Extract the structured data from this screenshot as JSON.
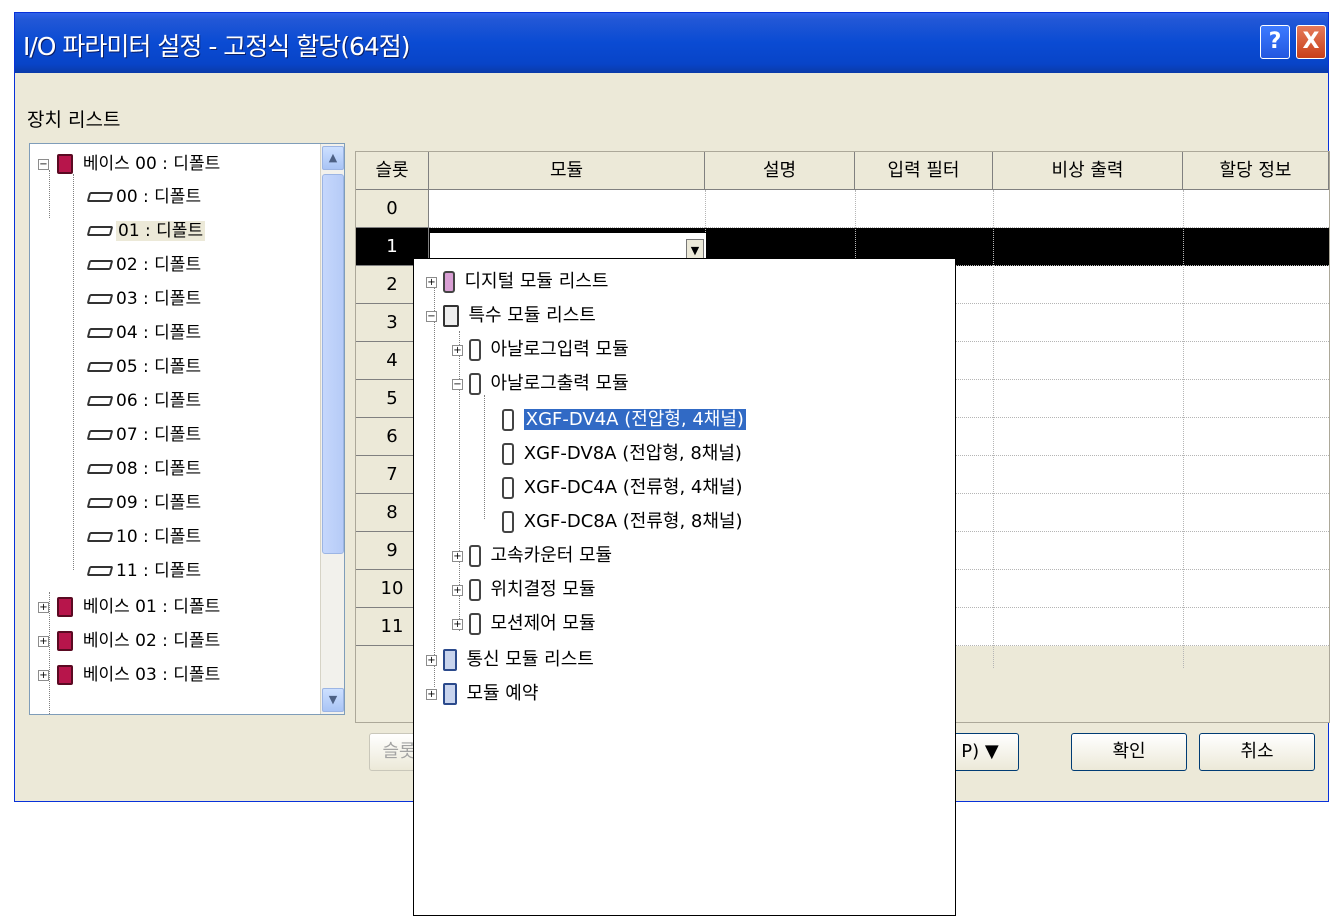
{
  "window": {
    "title": "I/O 파라미터 설정 - 고정식 할당(64점)",
    "help": "?",
    "close": "X"
  },
  "device_list_label": "장치 리스트",
  "tree": {
    "bases": [
      {
        "label": "베이스 00 : 디폴트",
        "expander": "−"
      },
      {
        "label": "베이스 01 : 디폴트",
        "expander": "+"
      },
      {
        "label": "베이스 02 : 디폴트",
        "expander": "+"
      },
      {
        "label": "베이스 03 : 디폴트",
        "expander": "+"
      }
    ],
    "slots": [
      "00 : 디폴트",
      "01 : 디폴트",
      "02 : 디폴트",
      "03 : 디폴트",
      "04 : 디폴트",
      "05 : 디폴트",
      "06 : 디폴트",
      "07 : 디폴트",
      "08 : 디폴트",
      "09 : 디폴트",
      "10 : 디폴트",
      "11 : 디폴트"
    ],
    "selected_slot": "01 : 디폴트"
  },
  "grid": {
    "columns": [
      "슬롯",
      "모듈",
      "설명",
      "입력 필터",
      "비상 출력",
      "할당 정보"
    ],
    "rows": [
      "0",
      "1",
      "2",
      "3",
      "4",
      "5",
      "6",
      "7",
      "8",
      "9",
      "10",
      "11"
    ],
    "selected_row": "1"
  },
  "popup": {
    "items": [
      {
        "label": "디지털 모듈 리스트",
        "expander": "+"
      },
      {
        "label": "특수 모듈 리스트",
        "expander": "−"
      },
      {
        "label": "아날로그입력 모듈",
        "expander": "+"
      },
      {
        "label": "아날로그출력 모듈",
        "expander": "−"
      },
      {
        "label": "XGF-DV4A (전압형, 4채널)"
      },
      {
        "label": "XGF-DV8A (전압형, 8채널)"
      },
      {
        "label": "XGF-DC4A (전류형, 4채널)"
      },
      {
        "label": "XGF-DC8A (전류형, 8채널)"
      },
      {
        "label": "고속카운터 모듈",
        "expander": "+"
      },
      {
        "label": "위치결정 모듈",
        "expander": "+"
      },
      {
        "label": "모션제어 모듈",
        "expander": "+"
      },
      {
        "label": "통신 모듈 리스트",
        "expander": "+"
      },
      {
        "label": "모듈 예약",
        "expander": "+"
      }
    ],
    "highlighted": "XGF-DV4A (전압형, 4채널)"
  },
  "buttons": {
    "slot_partial": "슬롯",
    "print_partial": "P) ▼",
    "ok": "확인",
    "cancel": "취소"
  },
  "icons": {
    "combo_arrow": "▼",
    "scroll_up": "▲",
    "scroll_down": "▼"
  }
}
